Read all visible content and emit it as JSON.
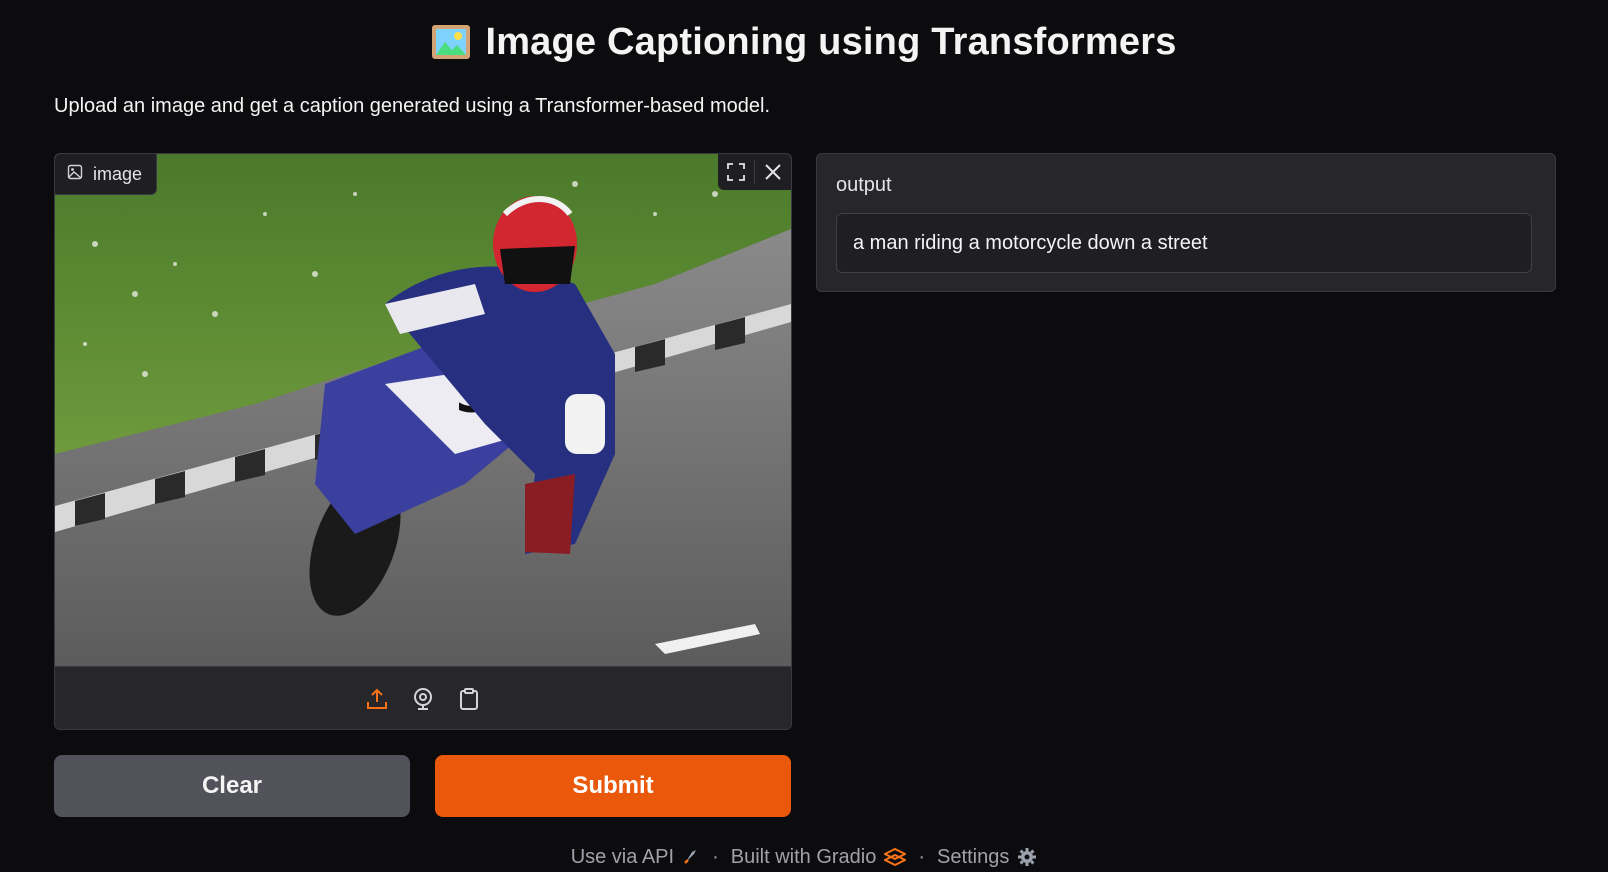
{
  "header": {
    "title": "Image Captioning using Transformers",
    "title_icon": "framed-picture-emoji",
    "description": "Upload an image and get a caption generated using a Transformer-based model."
  },
  "image_input": {
    "label": "image",
    "label_icon": "image-icon",
    "controls": [
      "fullscreen-icon",
      "close-icon"
    ],
    "sources": [
      "upload-icon",
      "webcam-icon",
      "clipboard-icon"
    ],
    "active_source_color": "#f97316"
  },
  "output": {
    "label": "output",
    "value": "a man riding a motorcycle down a street"
  },
  "buttons": {
    "clear": "Clear",
    "submit": "Submit"
  },
  "footer": {
    "api": "Use via API",
    "api_icon": "rocket-icon",
    "separator": "·",
    "built": "Built with Gradio",
    "built_icon": "gradio-logo-icon",
    "settings": "Settings",
    "settings_icon": "gear-icon"
  },
  "colors": {
    "background": "#0c0c0f",
    "panel": "#27272a",
    "accent": "#ea580c",
    "secondary_button": "#52525b"
  }
}
